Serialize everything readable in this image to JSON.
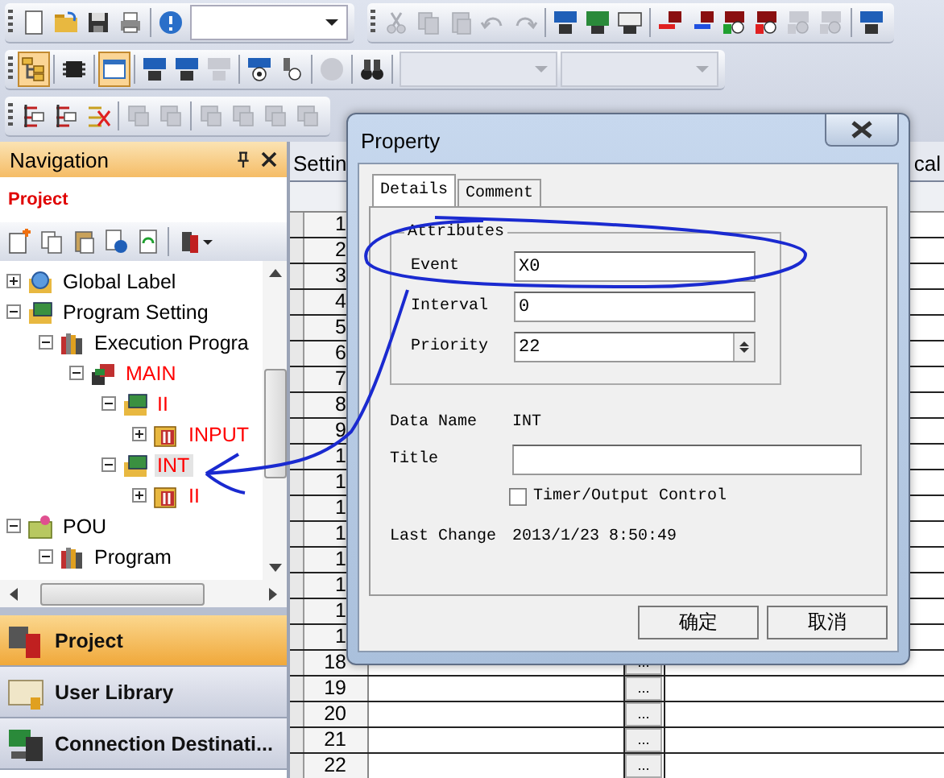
{
  "toolbar_rows": [
    [
      {
        "items": [
          {
            "kind": "button",
            "disabled": false,
            "pressed": false
          },
          {
            "kind": "button",
            "disabled": false,
            "pressed": false
          },
          {
            "kind": "button",
            "disabled": false,
            "pressed": false
          },
          {
            "kind": "button",
            "disabled": false,
            "pressed": false
          },
          {
            "kind": "separator"
          },
          {
            "kind": "button",
            "disabled": false,
            "pressed": false
          },
          {
            "kind": "combo",
            "disabled": false
          }
        ]
      },
      {
        "items": [
          {
            "kind": "button",
            "disabled": true,
            "pressed": false
          },
          {
            "kind": "button",
            "disabled": true,
            "pressed": false
          },
          {
            "kind": "button",
            "disabled": true,
            "pressed": false
          },
          {
            "kind": "button",
            "disabled": true,
            "pressed": false
          },
          {
            "kind": "button",
            "disabled": true,
            "pressed": false
          },
          {
            "kind": "separator"
          },
          {
            "kind": "button",
            "disabled": false,
            "pressed": false
          },
          {
            "kind": "button",
            "disabled": false,
            "pressed": false
          },
          {
            "kind": "button",
            "disabled": false,
            "pressed": false
          },
          {
            "kind": "separator"
          },
          {
            "kind": "button",
            "disabled": false,
            "pressed": false
          },
          {
            "kind": "button",
            "disabled": false,
            "pressed": false
          },
          {
            "kind": "button",
            "disabled": false,
            "pressed": false
          },
          {
            "kind": "button",
            "disabled": false,
            "pressed": false
          },
          {
            "kind": "button",
            "disabled": true,
            "pressed": false
          },
          {
            "kind": "button",
            "disabled": true,
            "pressed": false
          },
          {
            "kind": "separator"
          },
          {
            "kind": "button",
            "disabled": false,
            "pressed": false
          }
        ]
      }
    ],
    [
      {
        "items": [
          {
            "kind": "button",
            "disabled": false,
            "pressed": true
          },
          {
            "kind": "separator"
          },
          {
            "kind": "button",
            "disabled": false,
            "pressed": false
          },
          {
            "kind": "separator"
          },
          {
            "kind": "button",
            "disabled": false,
            "pressed": true
          },
          {
            "kind": "separator"
          },
          {
            "kind": "button",
            "disabled": false,
            "pressed": false
          },
          {
            "kind": "button",
            "disabled": false,
            "pressed": false
          },
          {
            "kind": "button",
            "disabled": true,
            "pressed": false
          },
          {
            "kind": "separator"
          },
          {
            "kind": "button",
            "disabled": false,
            "pressed": false
          },
          {
            "kind": "button",
            "disabled": false,
            "pressed": false
          },
          {
            "kind": "separator"
          },
          {
            "kind": "button",
            "disabled": true,
            "pressed": false
          },
          {
            "kind": "separator"
          },
          {
            "kind": "button",
            "disabled": false,
            "pressed": false
          },
          {
            "kind": "separator"
          },
          {
            "kind": "combo",
            "disabled": true
          },
          {
            "kind": "combo",
            "disabled": true
          }
        ]
      }
    ],
    [
      {
        "items": [
          {
            "kind": "button",
            "disabled": false,
            "pressed": false
          },
          {
            "kind": "button",
            "disabled": false,
            "pressed": false
          },
          {
            "kind": "button",
            "disabled": false,
            "pressed": false
          },
          {
            "kind": "separator"
          },
          {
            "kind": "button",
            "disabled": true,
            "pressed": false
          },
          {
            "kind": "button",
            "disabled": true,
            "pressed": false
          },
          {
            "kind": "separator"
          },
          {
            "kind": "button",
            "disabled": true,
            "pressed": false
          },
          {
            "kind": "button",
            "disabled": true,
            "pressed": false
          },
          {
            "kind": "button",
            "disabled": true,
            "pressed": false
          },
          {
            "kind": "button",
            "disabled": true,
            "pressed": false
          }
        ]
      }
    ]
  ],
  "navigation": {
    "title": "Navigation",
    "section": "Project",
    "tree": [
      {
        "label": "Global Label",
        "kind": "global",
        "color": "#000000",
        "expanded": false,
        "selected": false
      },
      {
        "label": "Program Setting",
        "kind": "setting",
        "color": "#000000",
        "expanded": true,
        "selected": false,
        "children": [
          {
            "label": "Execution Progra",
            "kind": "execution",
            "color": "#000000",
            "expanded": true,
            "selected": false,
            "children": [
              {
                "label": "MAIN",
                "kind": "program",
                "color": "#ff0000",
                "expanded": true,
                "selected": false,
                "children": [
                  {
                    "label": "II",
                    "kind": "task",
                    "color": "#ff0000",
                    "expanded": true,
                    "selected": false,
                    "children": [
                      {
                        "label": "INPUT",
                        "kind": "file",
                        "color": "#ff0000",
                        "expanded": false,
                        "selected": false
                      }
                    ]
                  },
                  {
                    "label": "INT",
                    "kind": "task",
                    "color": "#ff0000",
                    "expanded": true,
                    "selected": true,
                    "children": [
                      {
                        "label": "II",
                        "kind": "file",
                        "color": "#ff0000",
                        "expanded": false,
                        "selected": false
                      }
                    ]
                  }
                ]
              }
            ]
          }
        ]
      },
      {
        "label": "POU",
        "kind": "pou",
        "color": "#000000",
        "expanded": true,
        "selected": false,
        "children": [
          {
            "label": "Program",
            "kind": "execution",
            "color": "#000000",
            "expanded": true,
            "selected": false
          }
        ]
      }
    ],
    "panels": [
      {
        "label": "Project",
        "selected": true
      },
      {
        "label": "User Library",
        "selected": false
      },
      {
        "label": "Connection Destinati...",
        "selected": false
      }
    ]
  },
  "grid": {
    "tab_left": "Settin",
    "tab_right": "cal",
    "rows": [
      {
        "number": "1"
      },
      {
        "number": "2"
      },
      {
        "number": "3"
      },
      {
        "number": "4"
      },
      {
        "number": "5"
      },
      {
        "number": "6"
      },
      {
        "number": "7"
      },
      {
        "number": "8"
      },
      {
        "number": "9"
      },
      {
        "number": "1"
      },
      {
        "number": "1"
      },
      {
        "number": "1"
      },
      {
        "number": "1"
      },
      {
        "number": "1"
      },
      {
        "number": "1"
      },
      {
        "number": "1"
      },
      {
        "number": "1"
      },
      {
        "number": "18",
        "button": "..."
      },
      {
        "number": "19",
        "button": "..."
      },
      {
        "number": "20",
        "button": "..."
      },
      {
        "number": "21",
        "button": "..."
      },
      {
        "number": "22",
        "button": "..."
      }
    ]
  },
  "dialog": {
    "title": "Property",
    "tabs": [
      {
        "label": "Details",
        "selected": true
      },
      {
        "label": "Comment",
        "selected": false
      }
    ],
    "group": {
      "title": "Attributes",
      "fields": [
        {
          "label": "Event",
          "value": "X0",
          "kind": "text"
        },
        {
          "label": "Interval",
          "value": "0",
          "kind": "text"
        },
        {
          "label": "Priority",
          "value": "22",
          "kind": "spinner"
        }
      ]
    },
    "data_name": {
      "label": "Data Name",
      "value": "INT"
    },
    "title_field": {
      "label": "Title"
    },
    "checkbox": {
      "label": "Timer/Output Control",
      "checked": false
    },
    "last_change": {
      "label": "Last Change",
      "value": "2013/1/23 8:50:49"
    },
    "buttons": [
      "确定",
      "取消"
    ]
  }
}
